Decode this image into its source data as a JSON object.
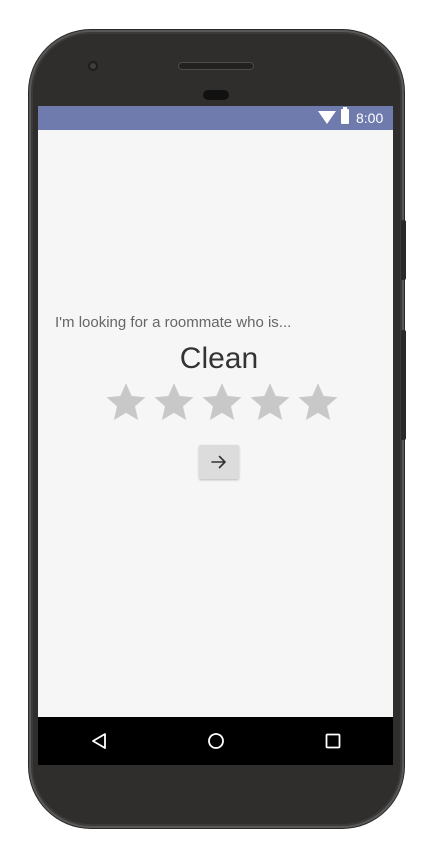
{
  "status_bar": {
    "time": "8:00",
    "color": "#6f7bad",
    "icons": [
      "wifi-icon",
      "battery-icon"
    ]
  },
  "main": {
    "prompt": "I'm looking for a roommate who is...",
    "trait": "Clean",
    "rating": {
      "max": 5,
      "selected": 0,
      "star_color": "#c8c8c8"
    },
    "next_button_icon": "arrow-right-icon"
  },
  "nav_bar": {
    "buttons": [
      "back-icon",
      "home-icon",
      "recents-icon"
    ]
  }
}
